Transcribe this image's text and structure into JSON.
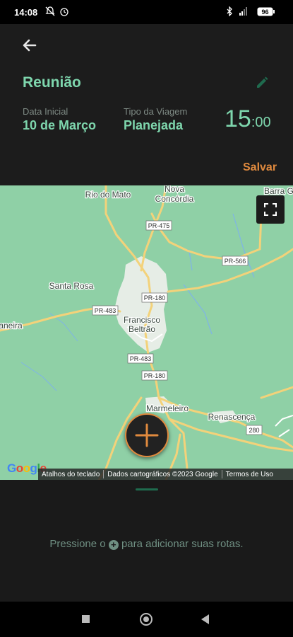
{
  "status_bar": {
    "time": "14:08",
    "battery": "96"
  },
  "header": {
    "back_icon": "arrow-left-icon",
    "title": "Reunião",
    "edit_icon": "pencil-icon",
    "start_date_label": "Data Inicial",
    "start_date_value": "10 de Março",
    "trip_type_label": "Tipo da Viagem",
    "trip_type_value": "Planejada",
    "time_hours": "15",
    "time_minutes": ":00",
    "save_label": "Salvar"
  },
  "map": {
    "places": [
      "Rio do Mato",
      "Nova",
      "Concórdia",
      "Santa Rosa",
      "aneira",
      "Francisco",
      "Beltrão",
      "Marmeleiro",
      "Renascença",
      "Barra G"
    ],
    "road_labels": [
      "PR-475",
      "PR-566",
      "PR-180",
      "PR-483",
      "PR-483",
      "PR-180",
      "280"
    ],
    "google_logo": "Google",
    "attribution": {
      "shortcuts": "Atalhos do teclado",
      "data": "Dados cartográficos ©2023 Google",
      "terms": "Termos de Uso"
    }
  },
  "colors": {
    "accent_green": "#7ed6ad",
    "accent_orange": "#e08a3e",
    "map_green": "#8fd0a6"
  },
  "bottom": {
    "hint_before": "Pressione o",
    "hint_after": "para adicionar suas rotas."
  }
}
